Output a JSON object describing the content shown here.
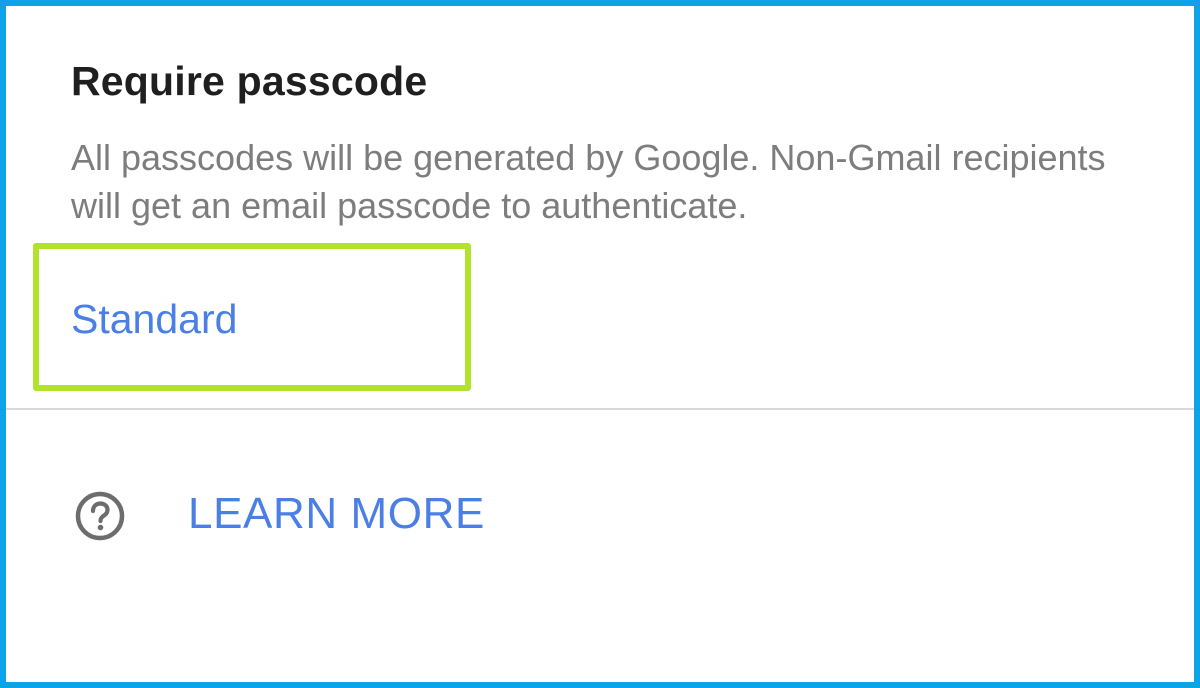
{
  "section": {
    "title": "Require passcode",
    "description": "All passcodes will be generated by Google. Non-Gmail recipients will get an email passcode to authenticate."
  },
  "option": {
    "label": "Standard"
  },
  "help": {
    "icon": "help-circle-icon",
    "label": "LEARN MORE"
  },
  "colors": {
    "frame_border": "#0ea2e8",
    "highlight_border": "#b2e22b",
    "link": "#4a7fe5",
    "title": "#1f1f1f",
    "description": "#7d7d7d"
  }
}
